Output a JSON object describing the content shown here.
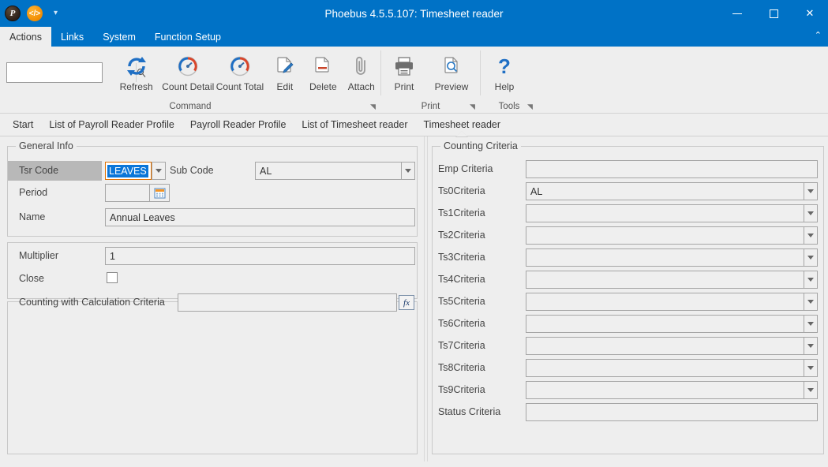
{
  "window": {
    "title": "Phoebus 4.5.5.107: Timesheet reader",
    "quick_access": [
      {
        "name": "phoebus-logo-icon",
        "glyph": "P"
      },
      {
        "name": "code-icon",
        "glyph": "</>"
      }
    ],
    "qat_caret": "▾",
    "controls": {
      "minimize": "minimize-icon",
      "maximize": "maximize-icon",
      "close": "✕"
    },
    "ribbon_collapse": "⌃",
    "accent_color": "#0072C6"
  },
  "ribbon": {
    "tabs": [
      {
        "label": "Actions",
        "active": true
      },
      {
        "label": "Links",
        "active": false
      },
      {
        "label": "System",
        "active": false
      },
      {
        "label": "Function Setup",
        "active": false
      }
    ],
    "search": {
      "value": "",
      "placeholder": ""
    },
    "groups": [
      {
        "label": "Command",
        "buttons": [
          {
            "label": "Refresh",
            "icon": "refresh-icon"
          },
          {
            "label": "Count Detail",
            "icon": "gauge-icon"
          },
          {
            "label": "Count Total",
            "icon": "gauge-icon"
          },
          {
            "label": "Edit",
            "icon": "edit-document-icon"
          },
          {
            "label": "Delete",
            "icon": "delete-document-icon"
          },
          {
            "label": "Attach",
            "icon": "paperclip-icon"
          }
        ],
        "launcher": "◥"
      },
      {
        "label": "Print",
        "buttons": [
          {
            "label": "Print",
            "icon": "printer-icon"
          },
          {
            "label": "Preview",
            "icon": "preview-icon"
          }
        ],
        "launcher": "◥"
      },
      {
        "label": "Tools",
        "buttons": [
          {
            "label": "Help",
            "icon": "question-mark-icon"
          }
        ],
        "launcher": "◥"
      }
    ]
  },
  "nav_tabs": [
    {
      "label": "Start",
      "active": false
    },
    {
      "label": "List of Payroll Reader Profile",
      "active": false
    },
    {
      "label": "Payroll Reader Profile",
      "active": false
    },
    {
      "label": "List of Timesheet reader",
      "active": false
    },
    {
      "label": "Timesheet reader",
      "active": true
    }
  ],
  "general_info": {
    "title": "General Info",
    "tsr_code": {
      "label": "Tsr Code",
      "value": "LEAVES",
      "selected": true
    },
    "sub_code": {
      "label": "Sub Code",
      "value": "AL"
    },
    "period": {
      "label": "Period",
      "value": "",
      "icon": "calendar-icon"
    },
    "name": {
      "label": "Name",
      "value": "Annual Leaves"
    }
  },
  "settings": {
    "multiplier": {
      "label": "Multiplier",
      "value": "1"
    },
    "close": {
      "label": "Close",
      "checked": false
    }
  },
  "calculation": {
    "label": "Counting with Calculation Criteria",
    "value": "",
    "fx_label": "fx"
  },
  "counting_criteria": {
    "title": "Counting Criteria",
    "rows": [
      {
        "label": "Emp Criteria",
        "value": "",
        "type": "text"
      },
      {
        "label": "Ts0Criteria",
        "value": "AL",
        "type": "combo"
      },
      {
        "label": "Ts1Criteria",
        "value": "",
        "type": "combo"
      },
      {
        "label": "Ts2Criteria",
        "value": "",
        "type": "combo"
      },
      {
        "label": "Ts3Criteria",
        "value": "",
        "type": "combo"
      },
      {
        "label": "Ts4Criteria",
        "value": "",
        "type": "combo"
      },
      {
        "label": "Ts5Criteria",
        "value": "",
        "type": "combo"
      },
      {
        "label": "Ts6Criteria",
        "value": "",
        "type": "combo"
      },
      {
        "label": "Ts7Criteria",
        "value": "",
        "type": "combo"
      },
      {
        "label": "Ts8Criteria",
        "value": "",
        "type": "combo"
      },
      {
        "label": "Ts9Criteria",
        "value": "",
        "type": "combo"
      },
      {
        "label": "Status Criteria",
        "value": "",
        "type": "text"
      }
    ]
  }
}
